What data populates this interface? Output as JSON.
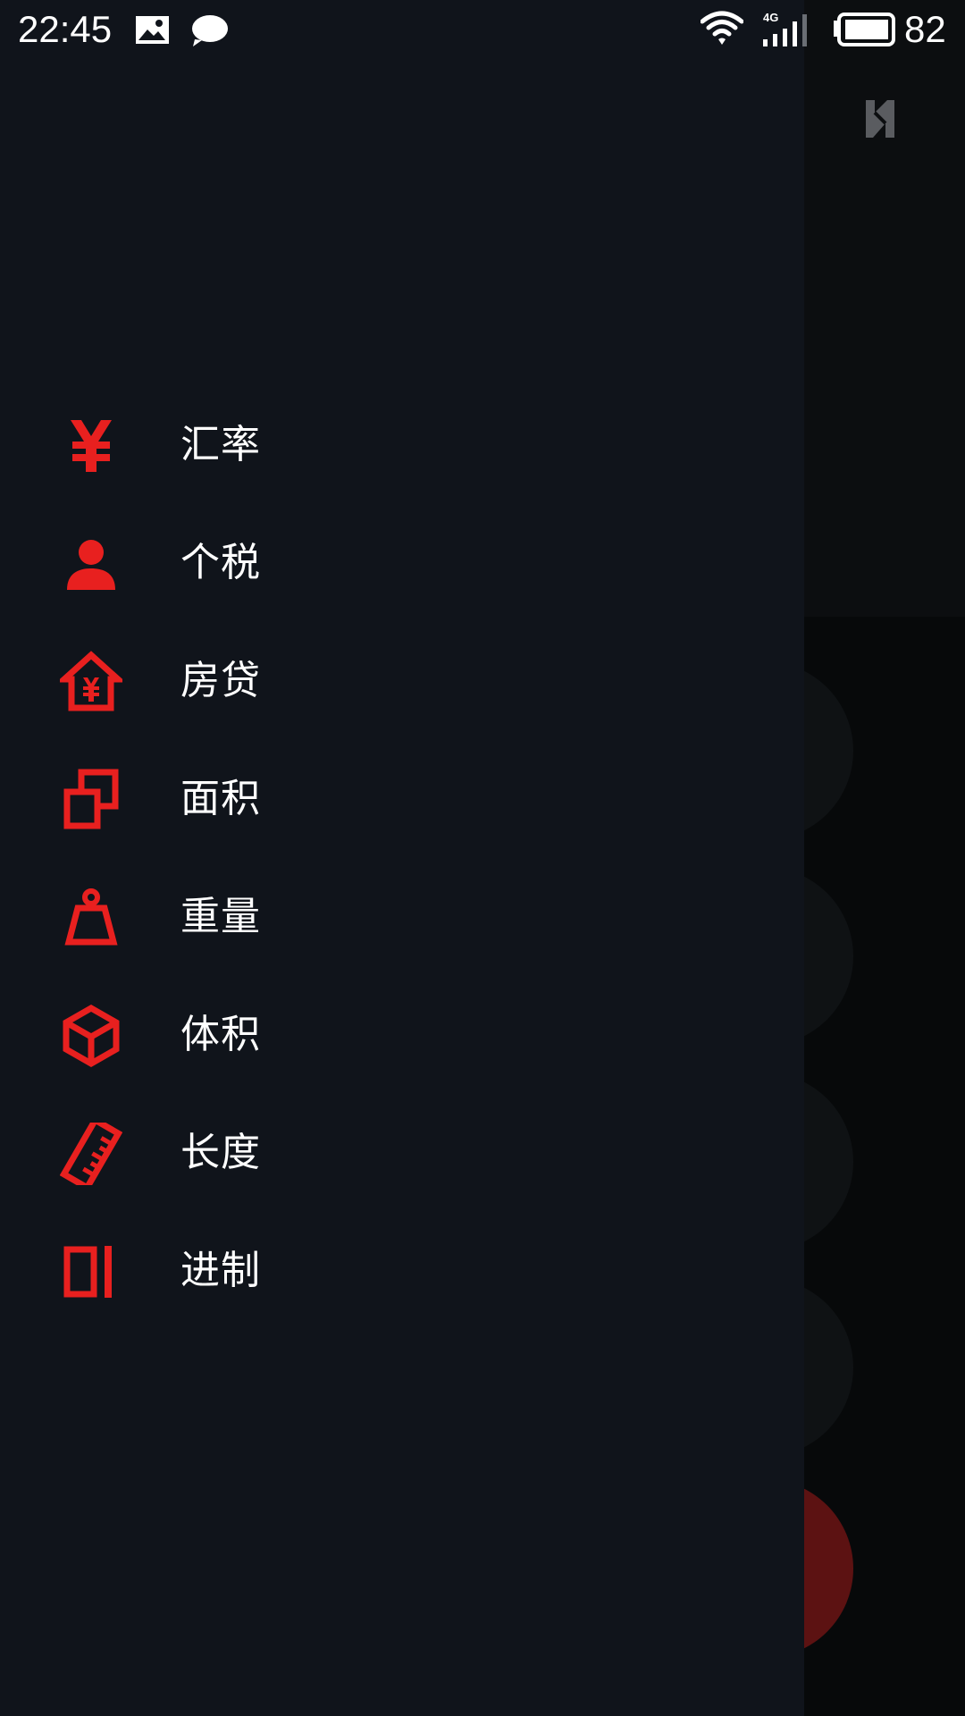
{
  "status_bar": {
    "time": "22:45",
    "network": "4G",
    "battery": "82",
    "icons": [
      "image-icon",
      "message-bubble-icon",
      "wifi-icon",
      "signal-icon",
      "battery-icon"
    ]
  },
  "drawer": {
    "accent_color": "#e8201f",
    "background_color": "#10141b",
    "items": [
      {
        "label": "汇率",
        "icon": "yen-icon"
      },
      {
        "label": "个税",
        "icon": "person-icon"
      },
      {
        "label": "房贷",
        "icon": "house-yen-icon"
      },
      {
        "label": "面积",
        "icon": "area-squares-icon"
      },
      {
        "label": "重量",
        "icon": "weight-icon"
      },
      {
        "label": "体积",
        "icon": "cube-icon"
      },
      {
        "label": "长度",
        "icon": "ruler-icon"
      },
      {
        "label": "进制",
        "icon": "number-base-icon"
      }
    ]
  },
  "background_app": {
    "header_action_icon": "dim-action-icon",
    "accent_button_color": "#5c1212"
  }
}
